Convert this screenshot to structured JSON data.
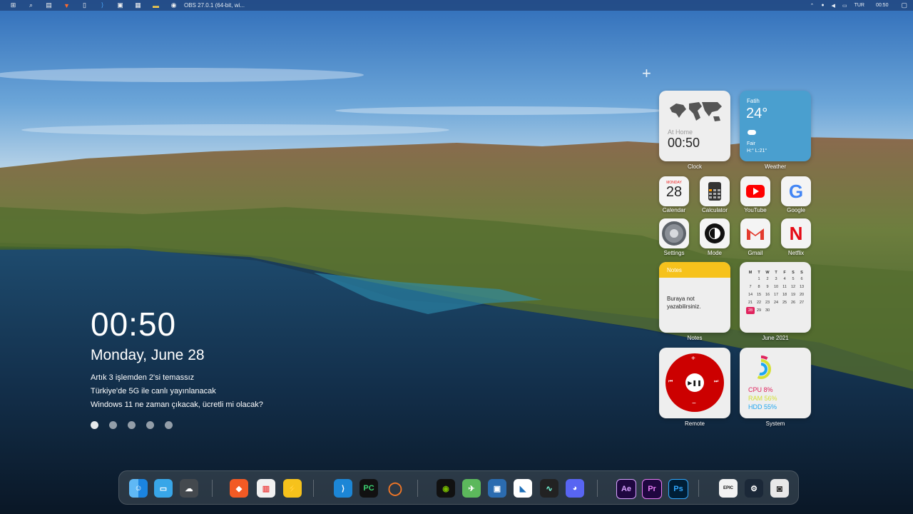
{
  "topbar": {
    "obs_title": "OBS 27.0.1 (64-bit, wi...",
    "lang": "TUR",
    "clock": "00:50"
  },
  "lockscreen": {
    "time": "00:50",
    "date": "Monday, June 28",
    "news": [
      "Artık 3 işlemden 2'si temassız",
      "Türkiye'de 5G ile canlı yayınlanacak",
      "Windows 11 ne zaman çıkacak, ücretli mi olacak?"
    ]
  },
  "widgets": {
    "clock": {
      "label": "Clock",
      "location": "At Home",
      "time": "00:50"
    },
    "weather": {
      "label": "Weather",
      "city": "Fatih",
      "temp": "24°",
      "condition": "Fair",
      "hilo": "H:° L:21°"
    },
    "notes": {
      "label": "Notes",
      "header": "Notes",
      "body": "Buraya not yazabilirsiniz."
    },
    "month_calendar": {
      "label": "June 2021",
      "weekdays": [
        "M",
        "T",
        "W",
        "T",
        "F",
        "S",
        "S"
      ],
      "weeks": [
        [
          "",
          "1",
          "2",
          "3",
          "4",
          "5",
          "6"
        ],
        [
          "7",
          "8",
          "9",
          "10",
          "11",
          "12",
          "13"
        ],
        [
          "14",
          "15",
          "16",
          "17",
          "18",
          "19",
          "20"
        ],
        [
          "21",
          "22",
          "23",
          "24",
          "25",
          "26",
          "27"
        ],
        [
          "28",
          "29",
          "30",
          "",
          "",
          "",
          ""
        ]
      ],
      "today": "28"
    },
    "remote": {
      "label": "Remote"
    },
    "system": {
      "label": "System",
      "cpu": "CPU 8%",
      "ram": "RAM 56%",
      "hdd": "HDD 55%"
    }
  },
  "apps": [
    {
      "label": "Calendar",
      "day": "MONDAY",
      "date": "28"
    },
    {
      "label": "Calculator"
    },
    {
      "label": "YouTube"
    },
    {
      "label": "Google"
    },
    {
      "label": "Settings"
    },
    {
      "label": "Mode"
    },
    {
      "label": "Gmail"
    },
    {
      "label": "Netflix"
    }
  ],
  "dock": {
    "ae": "Ae",
    "pr": "Pr",
    "ps": "Ps",
    "epic": "EPIC"
  },
  "colors": {
    "youtube": "#ff0000",
    "netflix": "#e50914",
    "remote": "#cc0000",
    "weather": "#4a9fcf",
    "notes_header": "#f6c21c",
    "cpu": "#e0245e",
    "ram": "#d4e034",
    "hdd": "#1ea7f0"
  }
}
